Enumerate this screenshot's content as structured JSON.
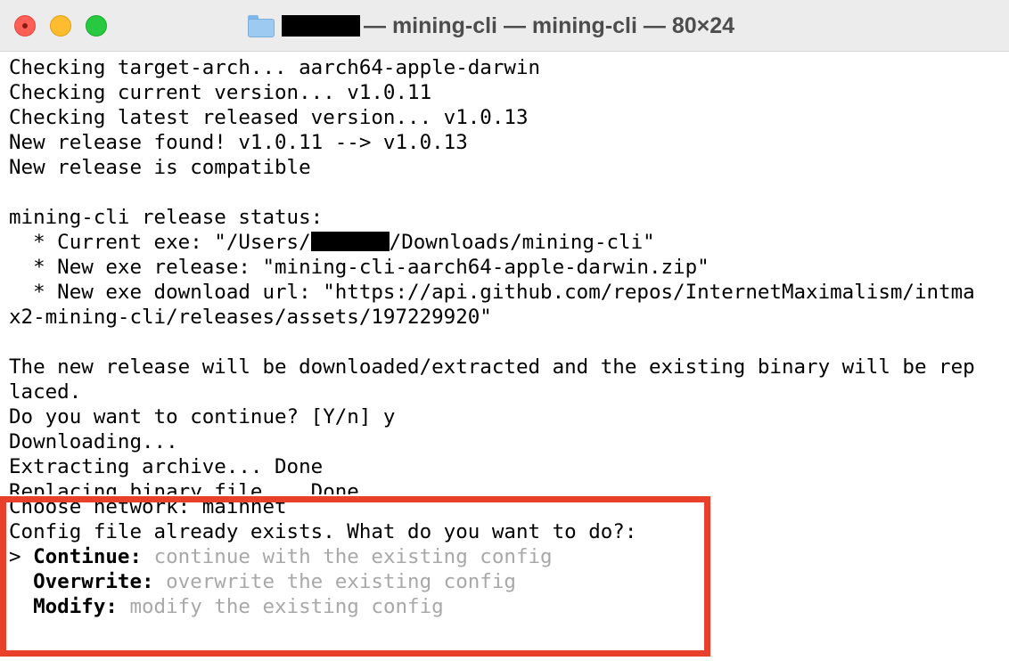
{
  "window": {
    "title_path": "— mining-cli — mining-cli — 80×24"
  },
  "terminal": {
    "lines": [
      "Checking target-arch... aarch64-apple-darwin",
      "Checking current version... v1.0.11",
      "Checking latest released version... v1.0.13",
      "New release found! v1.0.11 --> v1.0.13",
      "New release is compatible",
      "",
      "mining-cli release status:",
      "  * Current exe: \"/Users/",
      "/Downloads/mining-cli\"",
      "  * New exe release: \"mining-cli-aarch64-apple-darwin.zip\"",
      "  * New exe download url: \"https://api.github.com/repos/InternetMaximalism/intma",
      "x2-mining-cli/releases/assets/197229920\"",
      "",
      "The new release will be downloaded/extracted and the existing binary will be rep",
      "laced.",
      "Do you want to continue? [Y/n] y",
      "Downloading...",
      "Extracting archive... Done",
      "Replacing binary file... Done",
      "Choose network: mainnet",
      "Config file already exists. What do you want to do?:"
    ],
    "menu": {
      "cursor": "> ",
      "options": [
        {
          "label": "Continue:",
          "description": "continue with the existing config"
        },
        {
          "label": "Overwrite:",
          "description": "overwrite the existing config"
        },
        {
          "label": "Modify:",
          "description": "modify the existing config"
        }
      ]
    }
  },
  "icons": {
    "folder": "folder-icon"
  },
  "colors": {
    "highlight_border": "#e8402a",
    "option_description": "#a8a8a8",
    "close": "#ff5f57",
    "minimize": "#febc2e",
    "maximize": "#28c840"
  }
}
